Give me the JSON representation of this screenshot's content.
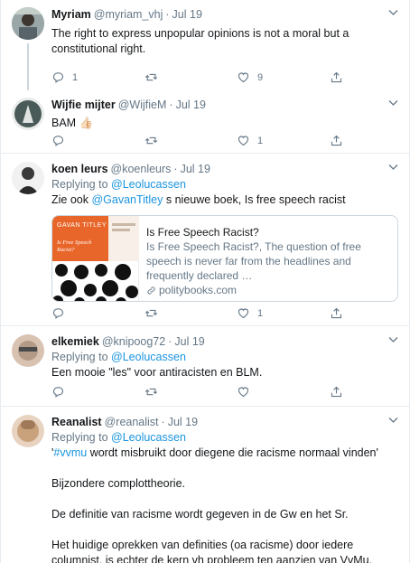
{
  "tweets": [
    {
      "name": "Myriam",
      "handle": "@myriam_vhj",
      "time": "Jul 19",
      "replying_prefix": "",
      "replying_to": "",
      "text_parts": [
        {
          "t": "The right to express unpopular opinions is not a moral but a constitutional right.",
          "link": false
        }
      ],
      "reply_count": "1",
      "retweet_count": "",
      "like_count": "9",
      "avatar_color": "#8a9aa0"
    },
    {
      "name": "Wijfie mijter",
      "handle": "@WijfieM",
      "time": "Jul 19",
      "replying_prefix": "",
      "replying_to": "",
      "text_parts": [
        {
          "t": "BAM 👍🏻",
          "link": false
        }
      ],
      "reply_count": "",
      "retweet_count": "",
      "like_count": "1",
      "avatar_color": "#4a5a58"
    },
    {
      "name": "koen leurs",
      "handle": "@koenleurs",
      "time": "Jul 19",
      "replying_prefix": "Replying to",
      "replying_to": "@Leolucassen",
      "text_parts": [
        {
          "t": "Zie ook ",
          "link": false
        },
        {
          "t": "@GavanTitley",
          "link": true
        },
        {
          "t": " s nieuwe boek, Is free speech racist",
          "link": false
        }
      ],
      "card": {
        "title": "Is Free Speech Racist?",
        "desc": "Is Free Speech Racist?, The question of free speech is never far from the headlines and frequently declared …",
        "domain": "politybooks.com",
        "book_author": "GAVAN TITLEY",
        "book_title": "Is Free Speech Racist?"
      },
      "reply_count": "",
      "retweet_count": "",
      "like_count": "1",
      "avatar_color": "#5d5d5d"
    },
    {
      "name": "elkemiek",
      "handle": "@knipoog72",
      "time": "Jul 19",
      "replying_prefix": "Replying to",
      "replying_to": "@Leolucassen",
      "text_parts": [
        {
          "t": "Een mooie \"les\" voor antiracisten en BLM.",
          "link": false
        }
      ],
      "reply_count": "",
      "retweet_count": "",
      "like_count": "",
      "avatar_color": "#b39a86"
    },
    {
      "name": "Reanalist",
      "handle": "@reanalist",
      "time": "Jul 19",
      "replying_prefix": "Replying to",
      "replying_to": "@Leolucassen",
      "paragraphs": [
        [
          {
            "t": "'",
            "link": false
          },
          {
            "t": "#vvmu",
            "link": true
          },
          {
            "t": " wordt misbruikt door diegene die racisme normaal vinden'",
            "link": false
          }
        ],
        [
          {
            "t": "Bijzondere complottheorie.",
            "link": false
          }
        ],
        [
          {
            "t": "De definitie van racisme wordt gegeven in de Gw en het Sr.",
            "link": false
          }
        ],
        [
          {
            "t": "Het huidige oprekken van definities (oa racisme) door iedere columnist, is echter de kern vh probleem ten aanzien van VvMu.",
            "link": false
          }
        ]
      ],
      "avatar_color": "#c9a27c"
    }
  ],
  "separator": "·",
  "colors": {
    "link": "#1b95e0",
    "muted": "#657786",
    "border": "#e6ecf0",
    "book_orange": "#e8662a"
  }
}
